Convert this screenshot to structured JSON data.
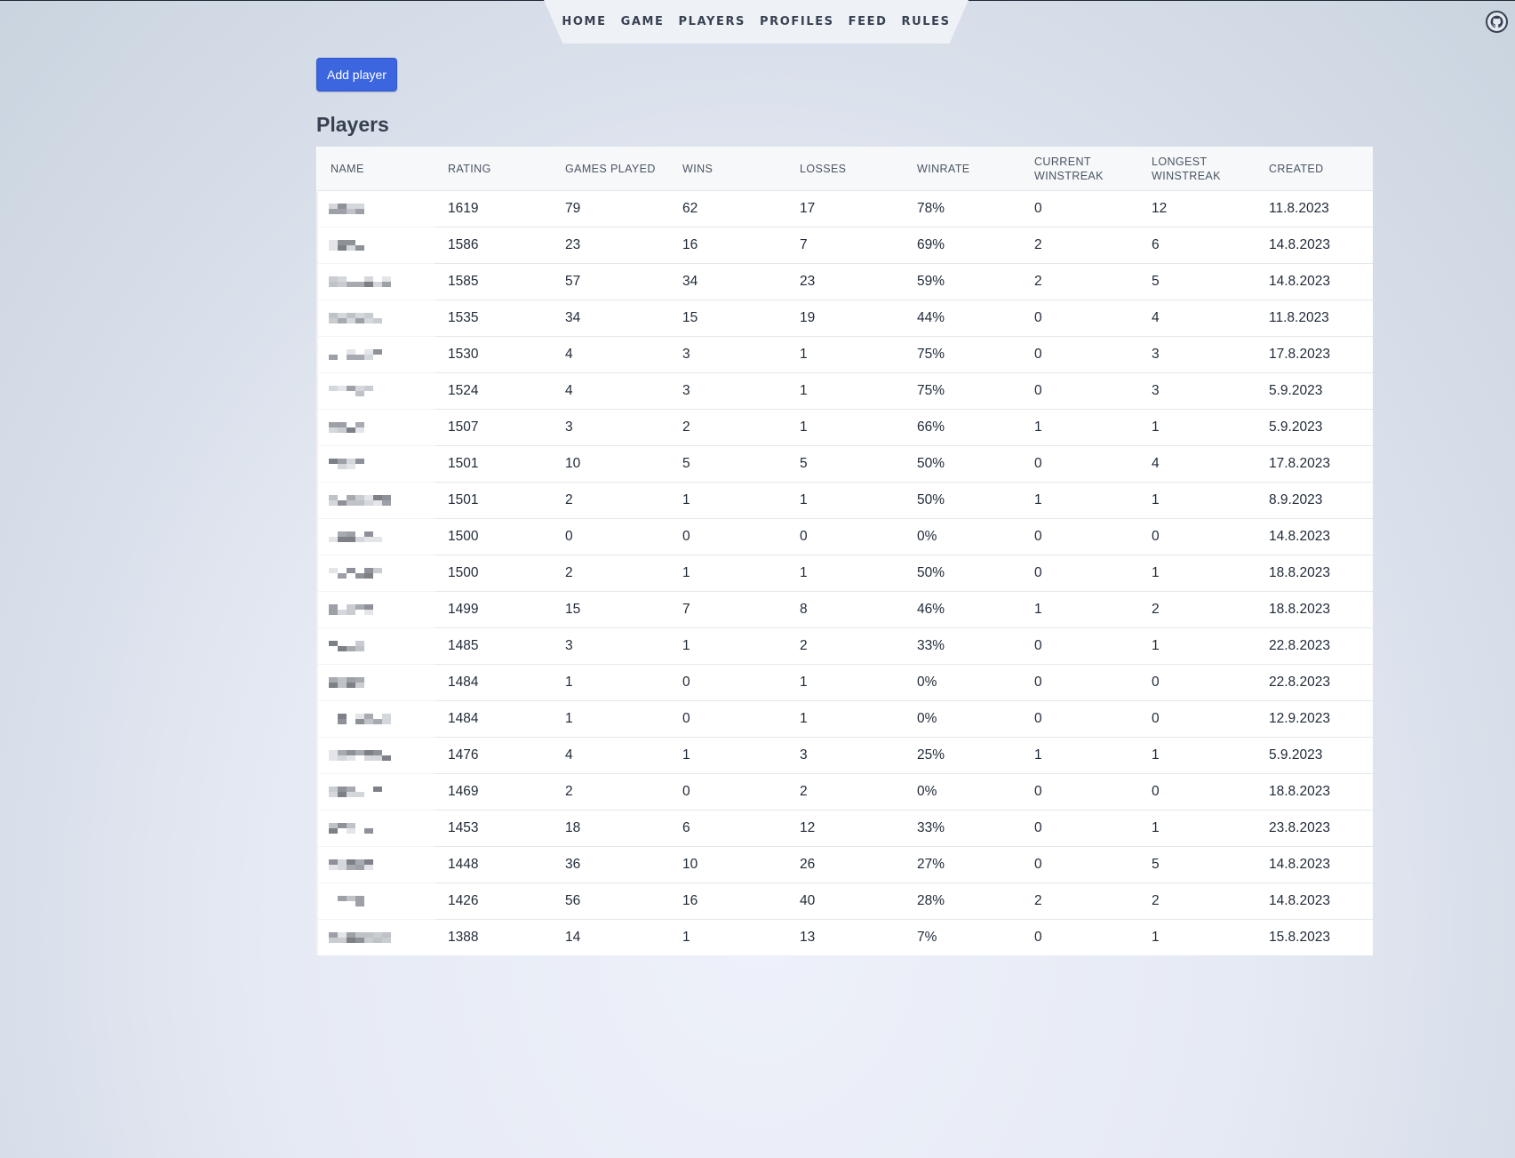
{
  "nav": {
    "items": [
      "HOME",
      "GAME",
      "PLAYERS",
      "PROFILES",
      "FEED",
      "RULES"
    ],
    "active": "PLAYERS"
  },
  "icons": {
    "github": "github-icon"
  },
  "actions": {
    "add_player_label": "Add player"
  },
  "colors": {
    "accent": "#3b66e0"
  },
  "page": {
    "title": "Players"
  },
  "table": {
    "columns": [
      "NAME",
      "RATING",
      "GAMES PLAYED",
      "WINS",
      "LOSSES",
      "WINRATE",
      "CURRENT WINSTREAK",
      "LONGEST WINSTREAK",
      "CREATED"
    ],
    "rows": [
      {
        "rating": "1619",
        "games": "79",
        "wins": "62",
        "losses": "17",
        "winrate": "78%",
        "current": "0",
        "longest": "12",
        "created": "11.8.2023"
      },
      {
        "rating": "1586",
        "games": "23",
        "wins": "16",
        "losses": "7",
        "winrate": "69%",
        "current": "2",
        "longest": "6",
        "created": "14.8.2023"
      },
      {
        "rating": "1585",
        "games": "57",
        "wins": "34",
        "losses": "23",
        "winrate": "59%",
        "current": "2",
        "longest": "5",
        "created": "14.8.2023"
      },
      {
        "rating": "1535",
        "games": "34",
        "wins": "15",
        "losses": "19",
        "winrate": "44%",
        "current": "0",
        "longest": "4",
        "created": "11.8.2023"
      },
      {
        "rating": "1530",
        "games": "4",
        "wins": "3",
        "losses": "1",
        "winrate": "75%",
        "current": "0",
        "longest": "3",
        "created": "17.8.2023"
      },
      {
        "rating": "1524",
        "games": "4",
        "wins": "3",
        "losses": "1",
        "winrate": "75%",
        "current": "0",
        "longest": "3",
        "created": "5.9.2023"
      },
      {
        "rating": "1507",
        "games": "3",
        "wins": "2",
        "losses": "1",
        "winrate": "66%",
        "current": "1",
        "longest": "1",
        "created": "5.9.2023"
      },
      {
        "rating": "1501",
        "games": "10",
        "wins": "5",
        "losses": "5",
        "winrate": "50%",
        "current": "0",
        "longest": "4",
        "created": "17.8.2023"
      },
      {
        "rating": "1501",
        "games": "2",
        "wins": "1",
        "losses": "1",
        "winrate": "50%",
        "current": "1",
        "longest": "1",
        "created": "8.9.2023"
      },
      {
        "rating": "1500",
        "games": "0",
        "wins": "0",
        "losses": "0",
        "winrate": "0%",
        "current": "0",
        "longest": "0",
        "created": "14.8.2023"
      },
      {
        "rating": "1500",
        "games": "2",
        "wins": "1",
        "losses": "1",
        "winrate": "50%",
        "current": "0",
        "longest": "1",
        "created": "18.8.2023"
      },
      {
        "rating": "1499",
        "games": "15",
        "wins": "7",
        "losses": "8",
        "winrate": "46%",
        "current": "1",
        "longest": "2",
        "created": "18.8.2023"
      },
      {
        "rating": "1485",
        "games": "3",
        "wins": "1",
        "losses": "2",
        "winrate": "33%",
        "current": "0",
        "longest": "1",
        "created": "22.8.2023"
      },
      {
        "rating": "1484",
        "games": "1",
        "wins": "0",
        "losses": "1",
        "winrate": "0%",
        "current": "0",
        "longest": "0",
        "created": "22.8.2023"
      },
      {
        "rating": "1484",
        "games": "1",
        "wins": "0",
        "losses": "1",
        "winrate": "0%",
        "current": "0",
        "longest": "0",
        "created": "12.9.2023"
      },
      {
        "rating": "1476",
        "games": "4",
        "wins": "1",
        "losses": "3",
        "winrate": "25%",
        "current": "1",
        "longest": "1",
        "created": "5.9.2023"
      },
      {
        "rating": "1469",
        "games": "2",
        "wins": "0",
        "losses": "2",
        "winrate": "0%",
        "current": "0",
        "longest": "0",
        "created": "18.8.2023"
      },
      {
        "rating": "1453",
        "games": "18",
        "wins": "6",
        "losses": "12",
        "winrate": "33%",
        "current": "0",
        "longest": "1",
        "created": "23.8.2023"
      },
      {
        "rating": "1448",
        "games": "36",
        "wins": "10",
        "losses": "26",
        "winrate": "27%",
        "current": "0",
        "longest": "5",
        "created": "14.8.2023"
      },
      {
        "rating": "1426",
        "games": "56",
        "wins": "16",
        "losses": "40",
        "winrate": "28%",
        "current": "2",
        "longest": "2",
        "created": "14.8.2023"
      },
      {
        "rating": "1388",
        "games": "14",
        "wins": "1",
        "losses": "13",
        "winrate": "7%",
        "current": "0",
        "longest": "1",
        "created": "15.8.2023"
      }
    ]
  }
}
